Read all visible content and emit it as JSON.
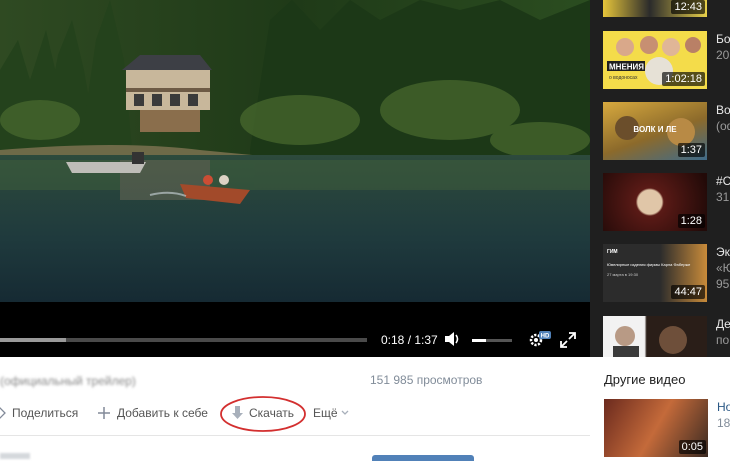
{
  "player": {
    "time": "0:18 / 1:37",
    "progress_fraction": 0.18,
    "volume_fraction": 0.35,
    "hd_badge": "HD",
    "icons": [
      "volume-icon",
      "gear-icon",
      "fullscreen-icon"
    ]
  },
  "sidebar": {
    "items": [
      {
        "duration": "12:43",
        "title": "",
        "meta": ""
      },
      {
        "duration": "1:02:18",
        "title": "Бо",
        "meta": "20",
        "thumb_label": "МНЕНИЯ",
        "thumb_sublabel": "о водоносах"
      },
      {
        "duration": "1:37",
        "title": "Во",
        "meta": "(оф",
        "thumb_label": "ВОЛК И ЛЕ"
      },
      {
        "duration": "1:28",
        "title": "#С",
        "meta": "31"
      },
      {
        "duration": "44:47",
        "title": "Эк",
        "meta": "«Ю",
        "meta2": "95",
        "thumb_label": "Ювелирные изделия фирмы Карла Фаберже",
        "thumb_sublabel": "27 марта в 19:30",
        "thumb_brand": "ГИМ"
      },
      {
        "duration": "",
        "title": "Де",
        "meta": "по"
      }
    ]
  },
  "video": {
    "title": "(официальный трейлер)",
    "views": "151 985 просмотров",
    "actions": {
      "share": "Поделиться",
      "add": "Добавить к себе",
      "download": "Скачать",
      "more": "Ещё"
    }
  },
  "other": {
    "heading": "Другие видео",
    "item": {
      "title": "Но",
      "meta": "184",
      "duration": "0:05"
    }
  },
  "colors": {
    "player_bg": "#000000",
    "sidebar_bg": "#1f1f1f",
    "link": "#2a5885",
    "annotation": "#d32f2f"
  }
}
